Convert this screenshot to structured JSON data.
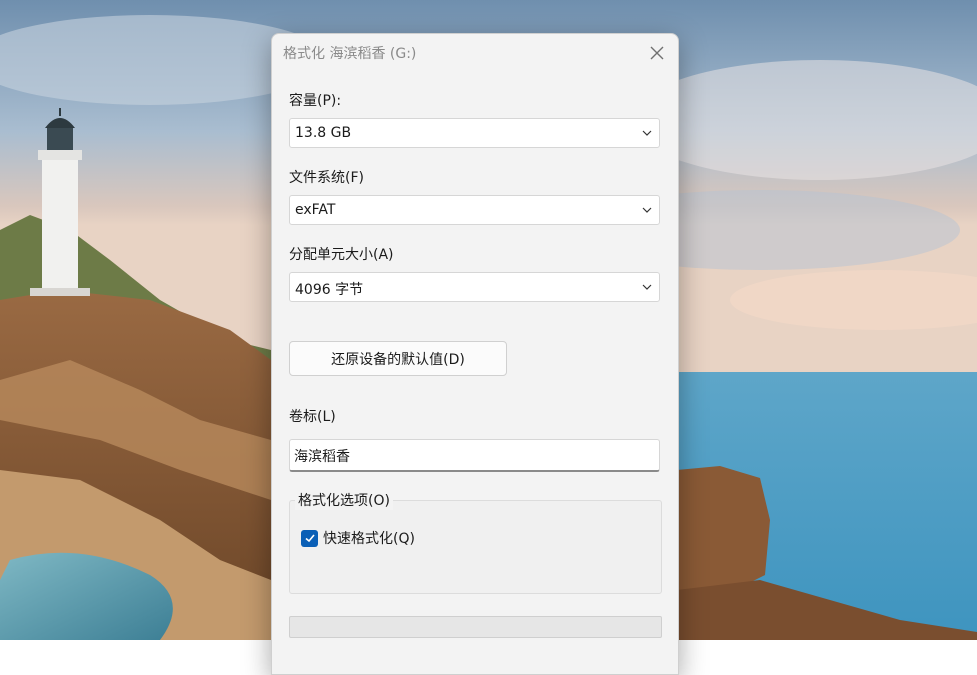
{
  "dialog": {
    "title": "格式化 海滨稻香 (G:)",
    "capacity": {
      "label": "容量(P):",
      "value": "13.8 GB"
    },
    "filesystem": {
      "label": "文件系统(F)",
      "value": "exFAT"
    },
    "allocation": {
      "label": "分配单元大小(A)",
      "value": "4096 字节"
    },
    "restore_button": "还原设备的默认值(D)",
    "volume": {
      "label": "卷标(L)",
      "value": "海滨稻香"
    },
    "options": {
      "legend": "格式化选项(O)",
      "quick_format": {
        "label": "快速格式化(Q)",
        "checked": true
      }
    },
    "progress": 0
  },
  "colors": {
    "accent": "#0a5fb6",
    "dialog_bg": "#f3f3f3",
    "progress_fill": "#06b025"
  },
  "icons": {
    "close": "close-icon",
    "dropdown": "chevron-down-icon",
    "checkmark": "checkmark-icon"
  }
}
